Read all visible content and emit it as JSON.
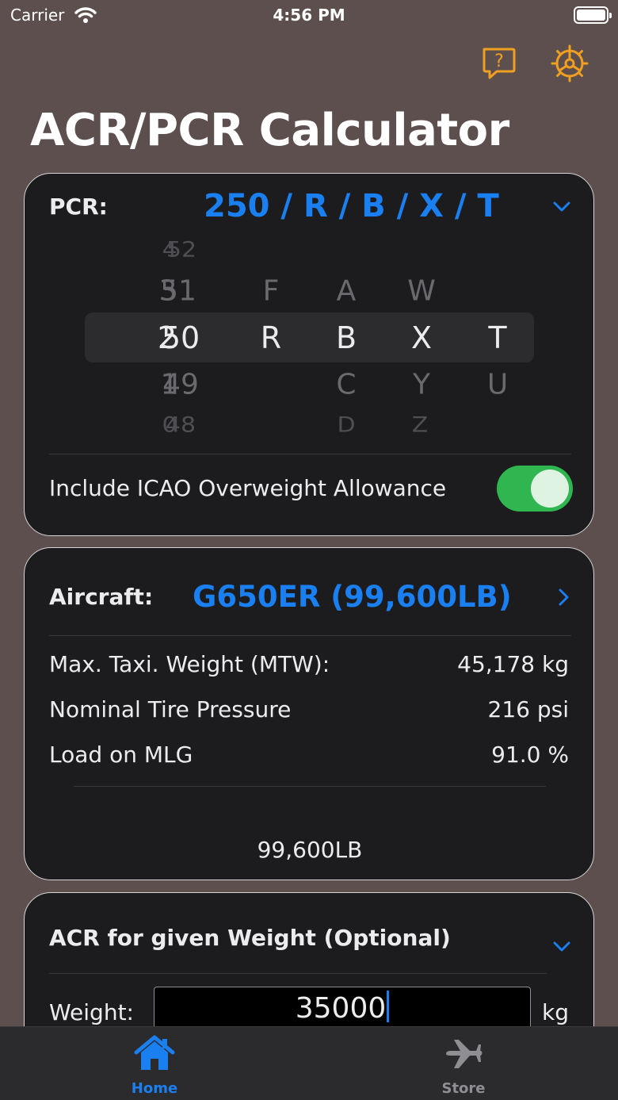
{
  "status_bar": {
    "carrier": "Carrier",
    "time": "4:56 PM"
  },
  "header": {
    "title": "ACR/PCR Calculator"
  },
  "pcr": {
    "label": "PCR:",
    "value": "250 / R / B / X / T",
    "picker": {
      "hundreds": [
        "4",
        "3",
        "2",
        "1",
        "0"
      ],
      "tens_units": [
        "52",
        "51",
        "50",
        "49",
        "48"
      ],
      "pavement": [
        "",
        "F",
        "R",
        "",
        ""
      ],
      "subgrade": [
        "",
        "A",
        "B",
        "C",
        "D"
      ],
      "tire_pressure": [
        "",
        "W",
        "X",
        "Y",
        "Z"
      ],
      "evaluation": [
        "",
        "",
        "T",
        "U",
        ""
      ]
    },
    "overweight_label": "Include ICAO Overweight Allowance",
    "overweight_enabled": true
  },
  "aircraft": {
    "label": "Aircraft:",
    "value": "G650ER (99,600LB)",
    "specs": [
      {
        "label": "Max. Taxi. Weight (MTW):",
        "value": "45,178 kg"
      },
      {
        "label": "Nominal Tire Pressure",
        "value": "216 psi"
      },
      {
        "label": "Load on MLG",
        "value": "91.0 %"
      }
    ],
    "weight_caption": "99,600LB"
  },
  "acr": {
    "title": "ACR for given Weight (Optional)",
    "weight_label": "Weight:",
    "weight_value": "35000",
    "weight_unit": "kg"
  },
  "tabs": [
    {
      "label": "Home",
      "icon": "house-icon",
      "active": true
    },
    {
      "label": "Store",
      "icon": "airplane-icon",
      "active": false
    }
  ],
  "colors": {
    "accent": "#1a7ff0",
    "toggle_on": "#30b650",
    "help_icon": "#f0a020",
    "background": "#5d4f4d"
  }
}
